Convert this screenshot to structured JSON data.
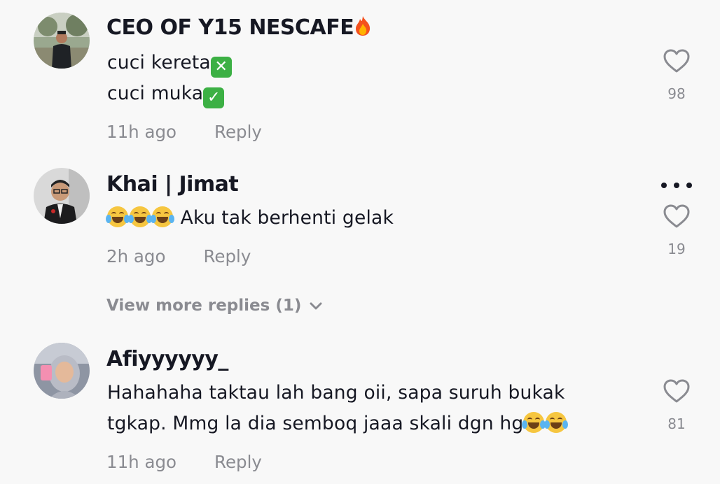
{
  "comments": [
    {
      "username": "CEO OF Y15 NESCAFE",
      "username_emoji": "fire-icon",
      "lines": [
        "cuci kereta",
        "cuci muka"
      ],
      "line_emojis": [
        "cross-mark-icon",
        "check-mark-icon"
      ],
      "time": "11h ago",
      "reply_label": "Reply",
      "likes": "98"
    },
    {
      "username": "Khai | Jimat",
      "lines": [
        "Aku tak berhenti gelak"
      ],
      "leading_emojis": [
        "laughing-tears-icon",
        "laughing-tears-icon",
        "laughing-tears-icon"
      ],
      "time": "2h ago",
      "reply_label": "Reply",
      "likes": "19",
      "view_more": "View more replies (1)"
    },
    {
      "username": "Afiyyyyyy_",
      "lines": [
        "Hahahaha taktau lah bang oii, sapa suruh bukak",
        "tgkap. Mmg la dia semboq jaaa skali dgn hg"
      ],
      "trailing_emojis": [
        "laughing-tears-icon",
        "laughing-tears-icon"
      ],
      "time": "11h ago",
      "reply_label": "Reply",
      "likes": "81"
    }
  ],
  "colors": {
    "background": "#f8f8f8",
    "text": "#161823",
    "muted": "#8a8b91",
    "check_green": "#3cb044",
    "cross_green": "#3cb044"
  }
}
